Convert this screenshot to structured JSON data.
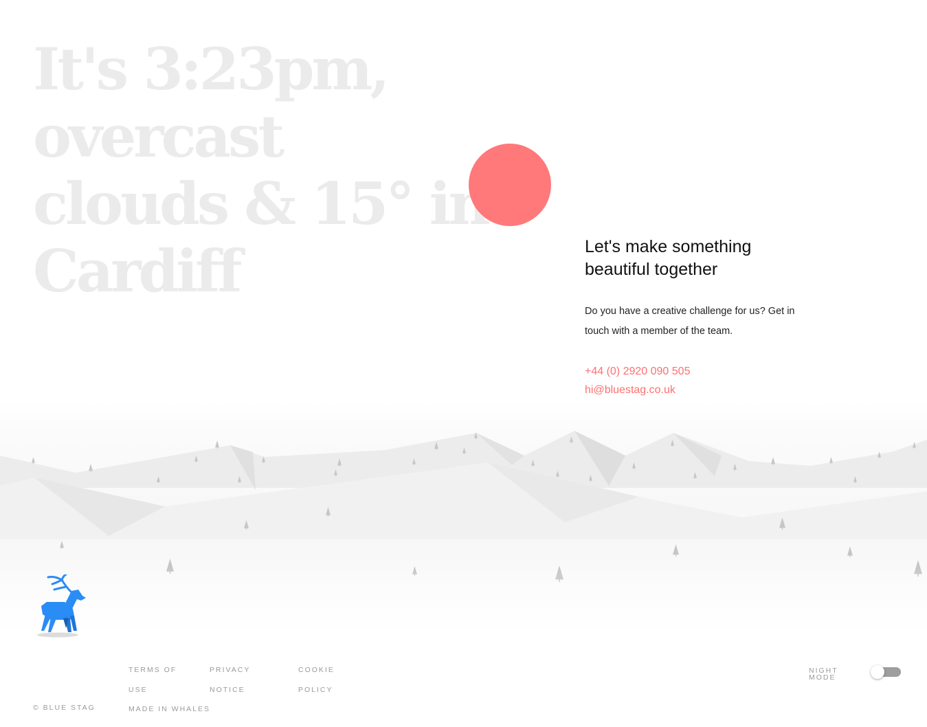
{
  "hero": {
    "line1": "It's 3:23pm,",
    "line2": "overcast",
    "line3": "clouds & 15° in",
    "line4": "Cardiff"
  },
  "contact": {
    "heading": "Let's make something beautiful together",
    "body": "Do you have a creative challenge for us? Get in touch with a member of the team.",
    "phone": "+44 (0) 2920 090 505",
    "email": "hi@bluestag.co.uk"
  },
  "footer": {
    "copyright": "© BLUE STAG",
    "links": {
      "terms": "TERMS OF USE",
      "privacy": "PRIVACY NOTICE",
      "cookie": "COOKIE POLICY",
      "made_in_whales": "MADE IN WHALES"
    },
    "night_mode": {
      "label": "NIGHT MODE",
      "enabled": false
    }
  },
  "icons": {
    "sun": "sun-icon",
    "stag": "blue-stag-icon"
  },
  "colors": {
    "sun": "#ff787a",
    "link": "#ff6f70",
    "headline": "#ebebeb",
    "stag": "#2a8cf5",
    "toggle_track": "#9e9e9e"
  }
}
